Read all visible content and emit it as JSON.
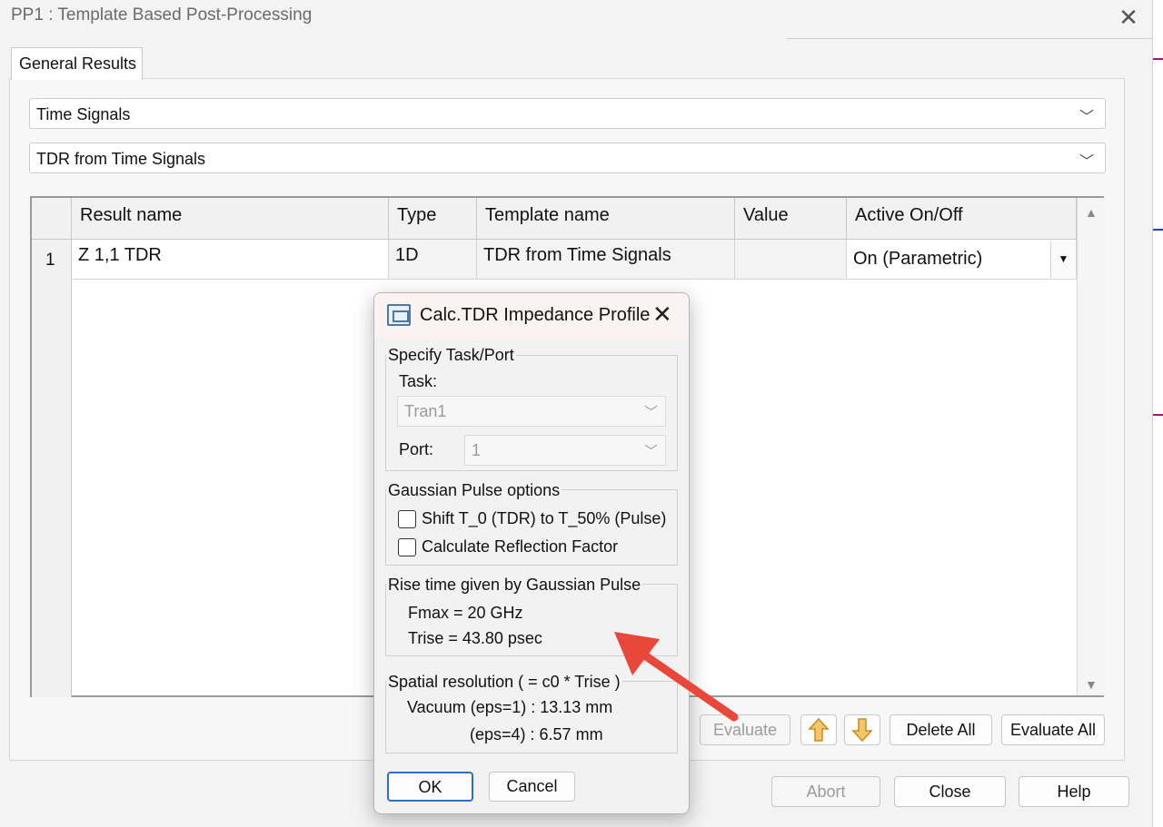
{
  "window": {
    "title": "PP1 : Template Based Post-Processing",
    "close_glyph": "✕"
  },
  "tabs": [
    {
      "label": "General Results"
    }
  ],
  "selectors": {
    "category": "Time Signals",
    "template": "TDR from Time Signals"
  },
  "table": {
    "headers": [
      "Result name",
      "Type",
      "Template name",
      "Value",
      "Active On/Off"
    ],
    "rows": [
      {
        "num": "1",
        "result_name": "Z 1,1 TDR",
        "type": "1D",
        "template_name": "TDR from Time Signals",
        "value": "",
        "active": "On (Parametric)"
      }
    ]
  },
  "buttons": {
    "evaluate": "Evaluate",
    "delete_all": "Delete All",
    "evaluate_all": "Evaluate All",
    "abort": "Abort",
    "close": "Close",
    "help": "Help",
    "move_up_icon": "arrow-up-icon",
    "move_down_icon": "arrow-down-icon"
  },
  "dialog": {
    "title": "Calc.TDR Impedance Profile",
    "close_glyph": "✕",
    "group_task": {
      "title": "Specify Task/Port",
      "task_label": "Task:",
      "task_value": "Tran1",
      "port_label": "Port:",
      "port_value": "1"
    },
    "group_gaussian": {
      "title": "Gaussian Pulse options",
      "shift_label": "Shift T_0 (TDR) to T_50% (Pulse)",
      "shift_checked": false,
      "reflection_label": "Calculate Reflection Factor",
      "reflection_checked": false
    },
    "group_rise": {
      "title": "Rise time given by Gaussian Pulse",
      "fmax": "Fmax  =  20 GHz",
      "trise": "Trise  =  43.80 psec"
    },
    "group_spatial": {
      "title": "Spatial resolution ( = c0 * Trise )",
      "vacuum": "Vacuum (eps=1) :  13.13 mm",
      "eps4": "(eps=4) :  6.57 mm"
    },
    "ok": "OK",
    "cancel": "Cancel"
  },
  "colors": {
    "annotation_arrow": "#e8473a",
    "ok_border": "#2f6fc7",
    "strip_accents": [
      "#9b1b6e",
      "#1f3fbf"
    ]
  }
}
